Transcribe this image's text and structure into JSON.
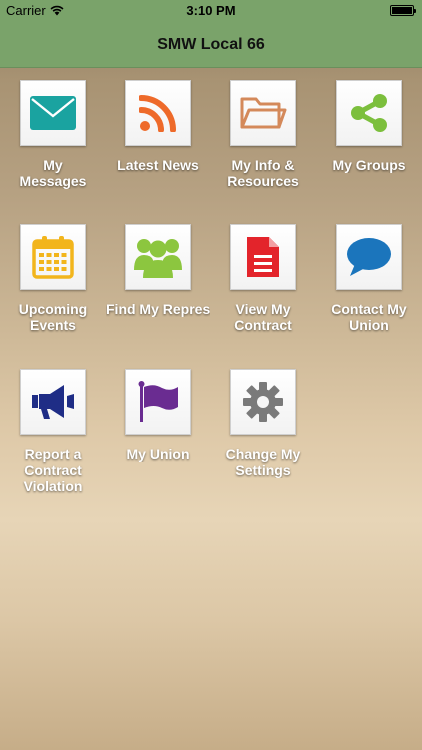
{
  "status_bar": {
    "carrier": "Carrier",
    "time": "3:10 PM"
  },
  "nav": {
    "title": "SMW Local 66"
  },
  "tiles": [
    {
      "label": "My\nMessages",
      "icon": "envelope-icon",
      "color": "#1aa3a0"
    },
    {
      "label": "Latest News",
      "icon": "rss-icon",
      "color": "#ee6a2a"
    },
    {
      "label": "My Info &\nResources",
      "icon": "folder-icon",
      "color": "#d4895a"
    },
    {
      "label": "My Groups",
      "icon": "share-icon",
      "color": "#7cbf3d"
    },
    {
      "label": "Upcoming\nEvents",
      "icon": "calendar-icon",
      "color": "#f2b51c"
    },
    {
      "label": "Find My\nRepresentative",
      "icon": "people-icon",
      "color": "#8cc63f"
    },
    {
      "label": "View My\nContract",
      "icon": "document-icon",
      "color": "#e3242b"
    },
    {
      "label": "Contact My\nUnion",
      "icon": "speech-bubble-icon",
      "color": "#1b75bc"
    },
    {
      "label": "Report a\nContract\nViolation",
      "icon": "megaphone-icon",
      "color": "#1f2d86"
    },
    {
      "label": "My Union",
      "icon": "flag-icon",
      "color": "#6a2c91"
    },
    {
      "label": "Change My\nSettings",
      "icon": "gear-icon",
      "color": "#7a7a7a"
    }
  ]
}
